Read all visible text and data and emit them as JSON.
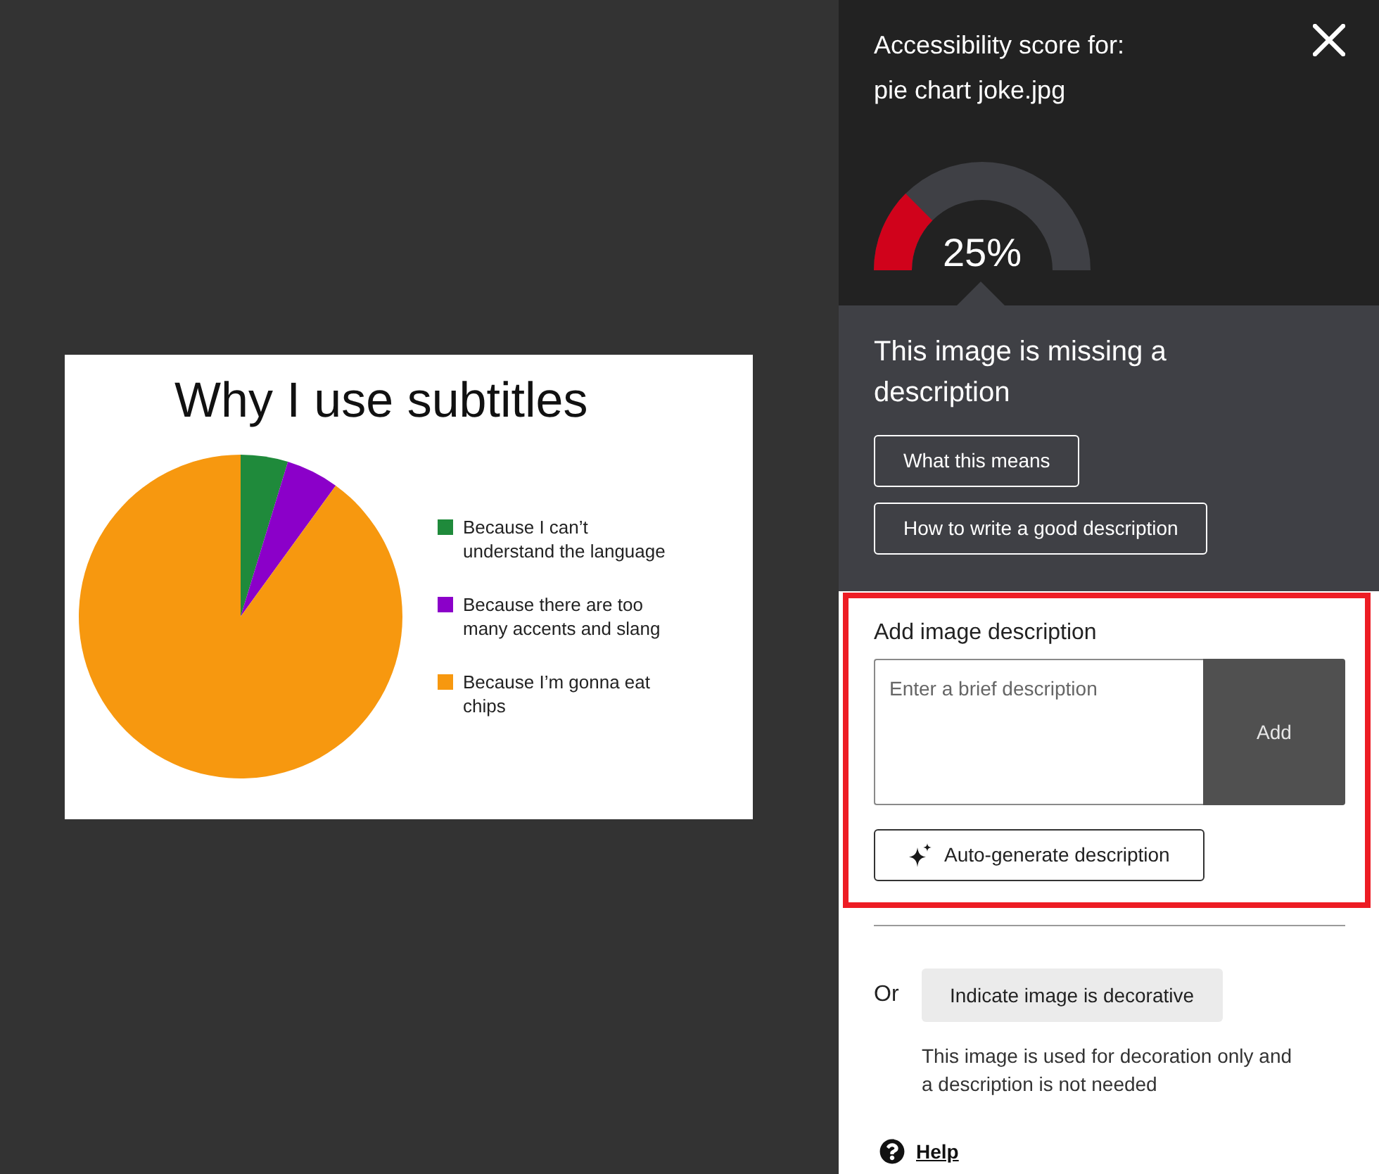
{
  "image_preview": {
    "title": "Why I use subtitles",
    "legend": [
      {
        "label": "Because I can’t understand the language",
        "color": "#1f8a3b"
      },
      {
        "label": "Because there are too many accents and slang",
        "color": "#8b00c9"
      },
      {
        "label": "Because I’m gonna eat chips",
        "color": "#f7980f"
      }
    ]
  },
  "panel": {
    "heading": "Accessibility score for:",
    "file_name": "pie chart joke.jpg",
    "score": {
      "level": 0.25,
      "reading": "25%"
    }
  },
  "status": {
    "message": "This image is missing a description",
    "buttons": [
      "What this means",
      "How to write a good description"
    ]
  },
  "description_form": {
    "highlighted": true,
    "label": "Add image description",
    "placeholder": "Enter a brief description",
    "submit": "Add",
    "auto_generate": "Auto-generate description"
  },
  "decorative": {
    "prefix": "Or",
    "button": "Indicate image is decorative",
    "note": "This image is used for decoration only and a description is not needed"
  },
  "help": "Help"
}
